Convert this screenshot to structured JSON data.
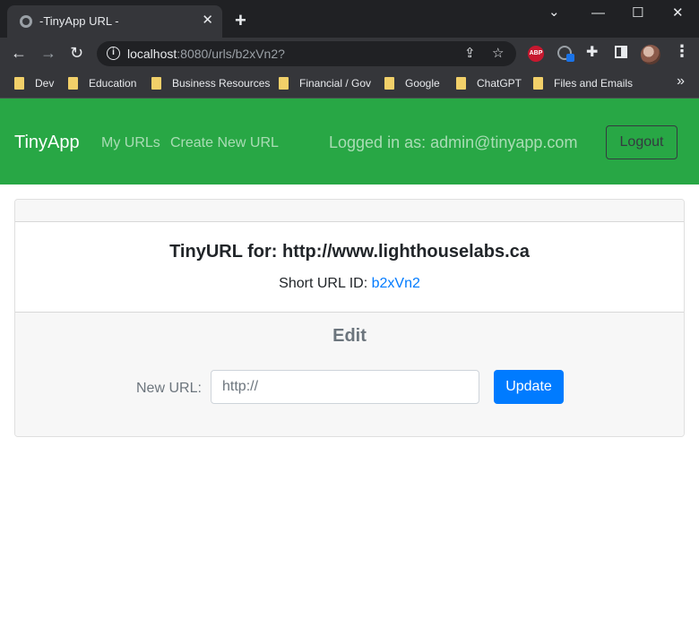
{
  "browser": {
    "tab_title": "-TinyApp URL -",
    "tab_close": "✕",
    "new_tab": "+",
    "url_host": "localhost",
    "url_rest": ":8080/urls/b2xVn2?",
    "bookmarks": [
      "Dev",
      "Education",
      "Business Resources",
      "Financial / Gov",
      "Google",
      "ChatGPT",
      "Files and Emails"
    ],
    "bookmarks_more": "»",
    "abp_label": "ABP"
  },
  "navbar": {
    "brand": "TinyApp",
    "links": [
      "My URLs",
      "Create New URL"
    ],
    "logged_in": "Logged in as: admin@tinyapp.com",
    "logout_label": "Logout",
    "color": "#28a745"
  },
  "card": {
    "title": "TinyURL for: http://www.lighthouselabs.ca",
    "short_id_label": "Short URL ID:",
    "short_id": "b2xVn2",
    "edit_title": "Edit",
    "new_url_label": "New URL:",
    "input_placeholder": "http://",
    "update_label": "Update"
  },
  "colors": {
    "link": "#007bff",
    "primary_button": "#007bff"
  }
}
